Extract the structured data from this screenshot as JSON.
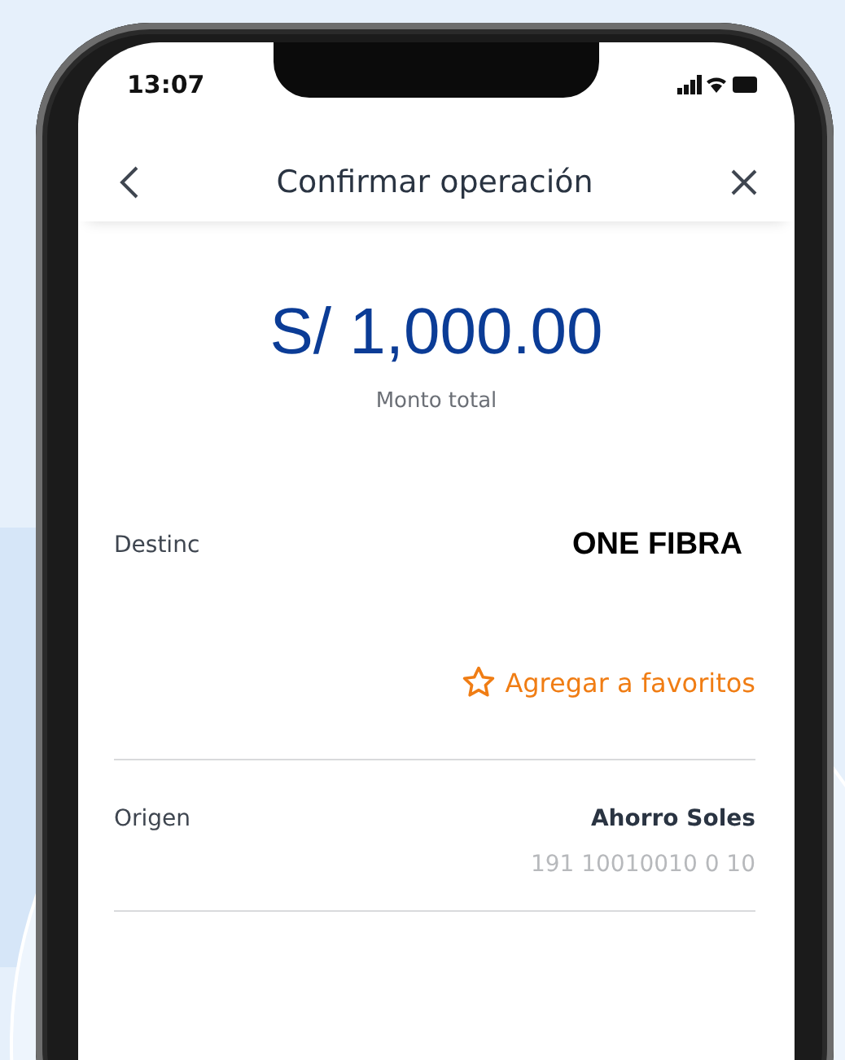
{
  "status_bar": {
    "time": "13:07"
  },
  "header": {
    "title": "Confirmar operación"
  },
  "amount": {
    "value": "S/ 1,000.00",
    "label": "Monto total"
  },
  "details": [
    {
      "kind": "destination",
      "label": "Destinc",
      "value": "ONE FIBRA",
      "action": "Agregar a favoritos"
    },
    {
      "kind": "origin",
      "label": "Origen",
      "value": "Ahorro Soles",
      "account": "191 10010010 0 10"
    }
  ]
}
